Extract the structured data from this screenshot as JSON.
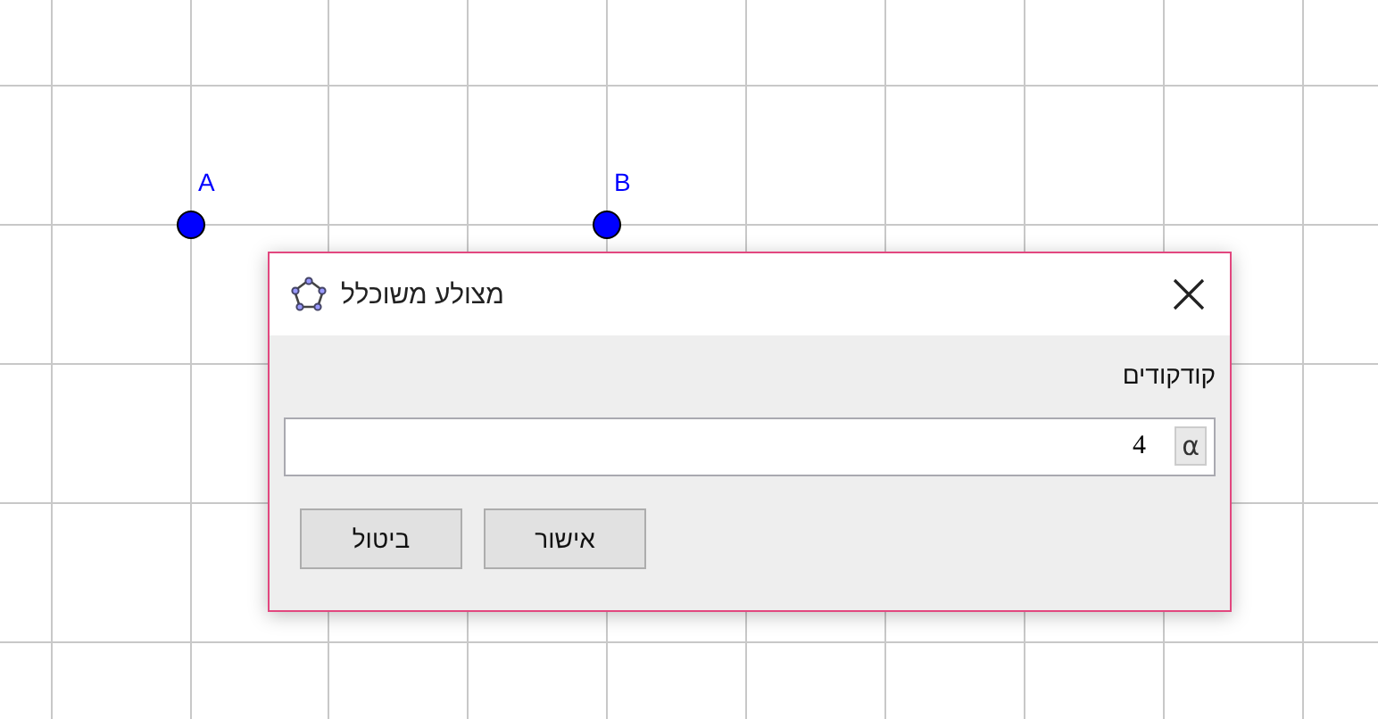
{
  "canvas": {
    "points": [
      {
        "label": "B"
      },
      {
        "label": "A"
      }
    ]
  },
  "dialog": {
    "title": "מצולע משוכלל",
    "field_label": "קודקודים",
    "input": {
      "value": "4"
    },
    "symbol_button": "α",
    "buttons": [
      {
        "label": "אישור"
      },
      {
        "label": "ביטול"
      }
    ]
  }
}
